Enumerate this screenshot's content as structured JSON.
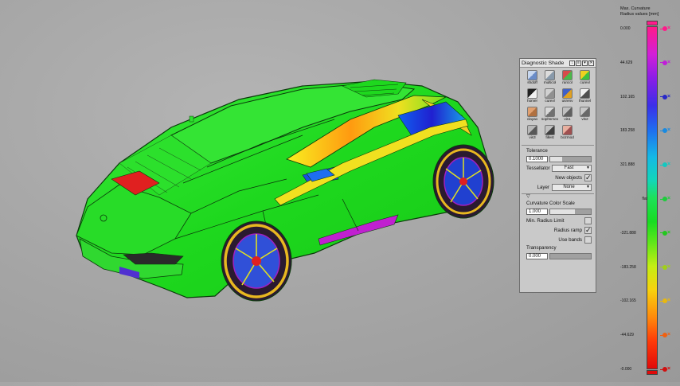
{
  "panel": {
    "title": "Diagnostic Shade",
    "tools": [
      {
        "label": "shdoff",
        "icon": "shade-off-icon",
        "colors": [
          "#c8d8f0",
          "#6a8cc8"
        ]
      },
      {
        "label": "multicol",
        "icon": "multi-color-icon",
        "colors": [
          "#dcdcdc",
          "#8899aa"
        ]
      },
      {
        "label": "rancol",
        "icon": "random-color-icon",
        "colors": [
          "#d84a4a",
          "#4ab84a"
        ]
      },
      {
        "label": "curevl",
        "icon": "curvature-eval-icon",
        "colors": [
          "#f0d020",
          "#40c040"
        ]
      },
      {
        "label": "horver",
        "icon": "horizontal-vertical-icon",
        "colors": [
          "#202020",
          "#f0f0f0"
        ]
      },
      {
        "label": "curevl",
        "icon": "curvature-eval-2-icon",
        "colors": [
          "#d0d0d0",
          "#909090"
        ]
      },
      {
        "label": "usrenv",
        "icon": "user-environment-icon",
        "colors": [
          "#4060c8",
          "#e0a020"
        ]
      },
      {
        "label": "lhunnel",
        "icon": "light-tunnel-icon",
        "colors": [
          "#f0f0f0",
          "#505050"
        ]
      },
      {
        "label": "clayao",
        "icon": "clay-ao-icon",
        "colors": [
          "#e0a070",
          "#b07040"
        ]
      },
      {
        "label": "sophsrnex",
        "icon": "sophisticated-icon",
        "colors": [
          "#d8d8d8",
          "#707070"
        ]
      },
      {
        "label": "vis1",
        "icon": "visual-1-icon",
        "colors": [
          "#c0c0c0",
          "#606060"
        ]
      },
      {
        "label": "vis2",
        "icon": "visual-2-icon",
        "colors": [
          "#c8c8c8",
          "#686868"
        ]
      },
      {
        "label": "vis3",
        "icon": "visual-3-icon",
        "colors": [
          "#b8b8b8",
          "#585858"
        ]
      },
      {
        "label": "fillest",
        "icon": "fill-test-icon",
        "colors": [
          "#c0c0c0",
          "#404040"
        ]
      },
      {
        "label": "bozmod",
        "icon": "boz-mode-icon",
        "colors": [
          "#e8b0a0",
          "#a05050"
        ]
      }
    ],
    "tolerance_label": "Tolerance",
    "tolerance_value": "0.1000",
    "tolerance_fraction": 0.3,
    "tessellator_label": "Tessellator",
    "tessellator_value": "Fast",
    "new_objects_label": "New objects",
    "new_objects_checked": true,
    "layer_label": "Layer",
    "layer_value": "None",
    "curvature_scale_label": "Curvature Color Scale",
    "curvature_scale_value": "1.000",
    "curvature_scale_fraction": 0.6,
    "min_radius_label": "Min. Radius Limit",
    "min_radius_checked": false,
    "radius_ramp_label": "Radius ramp",
    "radius_ramp_checked": true,
    "use_bands_label": "Use bands",
    "use_bands_checked": false,
    "transparency_label": "Transparency",
    "transparency_value": "0.000",
    "transparency_fraction": 0.0
  },
  "legend": {
    "title_line1": "Max. Curvature",
    "title_line2": "Radius values [mm]",
    "top_cap_color": "#ff1b8a",
    "bottom_cap_color": "#e00a0a",
    "ticks": [
      {
        "label": "0.000",
        "pos": 0.0,
        "color": "#ff1b8a"
      },
      {
        "label": "44.629",
        "pos": 0.1,
        "color": "#c01ed8"
      },
      {
        "label": "102.165",
        "pos": 0.2,
        "color": "#2828c8"
      },
      {
        "label": "183.258",
        "pos": 0.3,
        "color": "#1a8ae0"
      },
      {
        "label": "321.888",
        "pos": 0.4,
        "color": "#12c8c0"
      },
      {
        "label": "flat",
        "pos": 0.5,
        "color": "#1ecc3c"
      },
      {
        "label": "-321.888",
        "pos": 0.6,
        "color": "#22c81e"
      },
      {
        "label": "-183.258",
        "pos": 0.7,
        "color": "#a0d018"
      },
      {
        "label": "-102.165",
        "pos": 0.8,
        "color": "#e8b810"
      },
      {
        "label": "-44.629",
        "pos": 0.9,
        "color": "#f06010"
      },
      {
        "label": "-0.000",
        "pos": 1.0,
        "color": "#d01010"
      }
    ]
  },
  "viewport": {
    "body_color": "#22dd22",
    "accent_yellow": "#f0e020",
    "accent_blue": "#2040e0",
    "accent_magenta": "#c020c0",
    "wheel_color": "#e8b820"
  }
}
